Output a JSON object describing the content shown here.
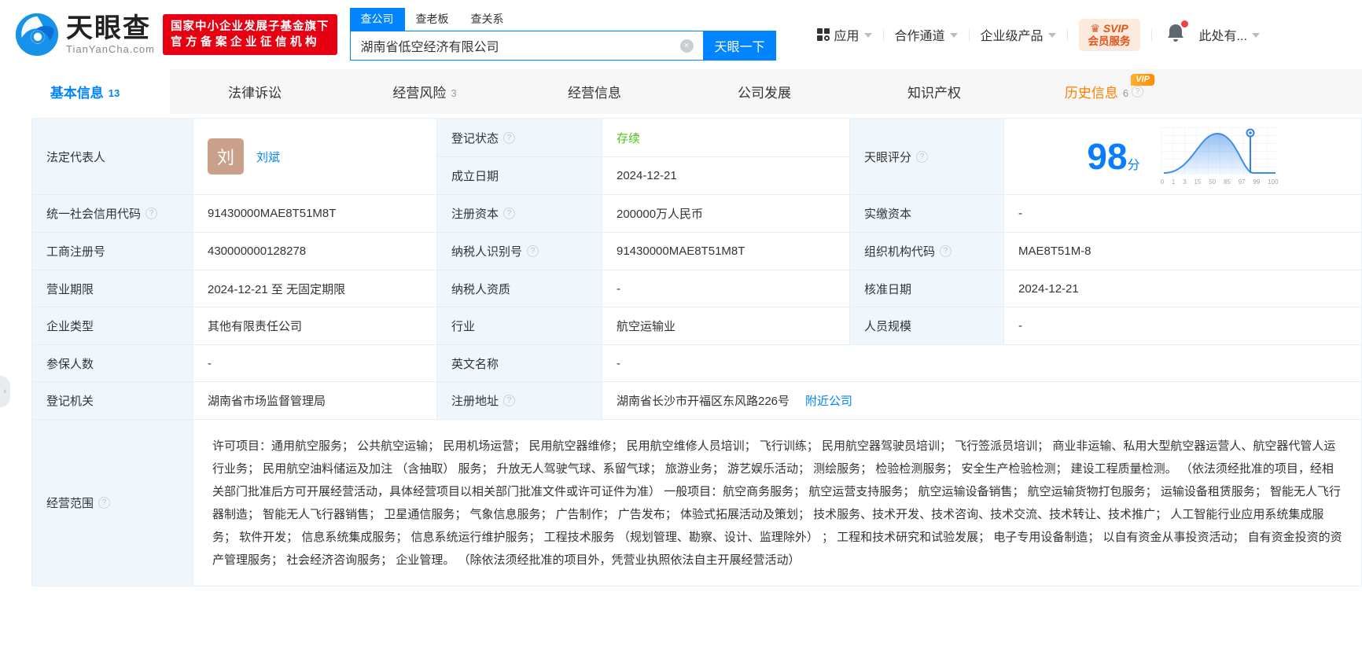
{
  "colors": {
    "accent_blue": "#0084ff",
    "status_green": "#52c41a",
    "history_orange": "#ff7e00",
    "badge_red": "#e60012",
    "score_blue": "#0a7cff",
    "avatar_tan": "#c9a089"
  },
  "icons": {
    "help": "?",
    "clear": "×",
    "crown": "♛",
    "collapse": "‹"
  },
  "header": {
    "logo": {
      "brand": "天眼查",
      "domain": "TianYanCha.com"
    },
    "badge_lines": {
      "l1": "国家中小企业发展子基金旗下",
      "l2": "官方备案企业征信机构"
    },
    "search": {
      "tabs": [
        {
          "label": "查公司"
        },
        {
          "label": "查老板"
        },
        {
          "label": "查关系"
        }
      ],
      "value": "湖南省低空经济有限公司",
      "button": "天眼一下"
    },
    "nav": [
      {
        "label": "应用"
      },
      {
        "label": "合作通道"
      },
      {
        "label": "企业级产品"
      }
    ],
    "svip": {
      "l1": "SVIP",
      "l2": "会员服务"
    },
    "user": "此处有..."
  },
  "tabs": {
    "items": [
      {
        "label": "基本信息",
        "count": "13"
      },
      {
        "label": "法律诉讼",
        "count": ""
      },
      {
        "label": "经营风险",
        "count": "3"
      },
      {
        "label": "经营信息",
        "count": ""
      },
      {
        "label": "公司发展",
        "count": ""
      },
      {
        "label": "知识产权",
        "count": ""
      },
      {
        "label": "历史信息",
        "count": "6",
        "vip": "VIP"
      }
    ]
  },
  "table": {
    "legal_rep": {
      "label": "法定代表人",
      "avatar": "刘",
      "name": "刘斌"
    },
    "reg_status": {
      "label": "登记状态",
      "value": "存续"
    },
    "establish": {
      "label": "成立日期",
      "value": "2024-12-21"
    },
    "score": {
      "label": "天眼评分",
      "value": "98",
      "unit": "分",
      "ticks": [
        "0",
        "1",
        "3",
        "15",
        "50",
        "85",
        "97",
        "99",
        "100"
      ],
      "marker_at": "97"
    },
    "rows": [
      {
        "cells": [
          {
            "label": "统一社会信用代码",
            "value": "91430000MAE8T51M8T"
          },
          {
            "label": "注册资本",
            "value": "200000万人民币"
          },
          {
            "label": "实缴资本",
            "value": "-"
          }
        ]
      },
      {
        "cells": [
          {
            "label": "工商注册号",
            "value": "430000000128278"
          },
          {
            "label": "纳税人识别号",
            "value": "91430000MAE8T51M8T"
          },
          {
            "label": "组织机构代码",
            "value": "MAE8T51M-8"
          }
        ]
      },
      {
        "cells": [
          {
            "label": "营业期限",
            "value": "2024-12-21 至 无固定期限"
          },
          {
            "label": "纳税人资质",
            "value": "-"
          },
          {
            "label": "核准日期",
            "value": "2024-12-21"
          }
        ]
      },
      {
        "cells": [
          {
            "label": "企业类型",
            "value": "其他有限责任公司"
          },
          {
            "label": "行业",
            "value": "航空运输业"
          },
          {
            "label": "人员规模",
            "value": "-"
          }
        ]
      },
      {
        "cells": [
          {
            "label": "参保人数",
            "value": "-"
          },
          {
            "label": "英文名称",
            "value": "-"
          }
        ]
      }
    ],
    "registry": {
      "label": "登记机关",
      "value": "湖南省市场监督管理局",
      "addr_label": "注册地址",
      "addr_value": "湖南省长沙市开福区东风路226号",
      "addr_link": "附近公司"
    },
    "scope": {
      "label": "经营范围",
      "text": "许可项目：通用航空服务； 公共航空运输； 民用机场运营； 民用航空器维修； 民用航空维修人员培训； 飞行训练； 民用航空器驾驶员培训； 飞行签派员培训； 商业非运输、私用大型航空器运营人、航空器代管人运行业务； 民用航空油料储运及加注 （含抽取） 服务； 升放无人驾驶气球、系留气球； 旅游业务； 游艺娱乐活动； 测绘服务； 检验检测服务； 安全生产检验检测； 建设工程质量检测。 （依法须经批准的项目，经相关部门批准后方可开展经营活动，具体经营项目以相关部门批准文件或许可证件为准） 一般项目：航空商务服务； 航空运营支持服务； 航空运输设备销售； 航空运输货物打包服务； 运输设备租赁服务； 智能无人飞行器制造； 智能无人飞行器销售； 卫星通信服务； 气象信息服务； 广告制作； 广告发布； 体验式拓展活动及策划； 技术服务、技术开发、技术咨询、技术交流、技术转让、技术推广； 人工智能行业应用系统集成服务； 软件开发； 信息系统集成服务； 信息系统运行维护服务； 工程技术服务 （规划管理、勘察、设计、监理除外） ； 工程和技术研究和试验发展； 电子专用设备制造； 以自有资金从事投资活动； 自有资金投资的资产管理服务； 社会经济咨询服务； 企业管理。 （除依法须经批准的项目外，凭营业执照依法自主开展经营活动）"
    }
  }
}
